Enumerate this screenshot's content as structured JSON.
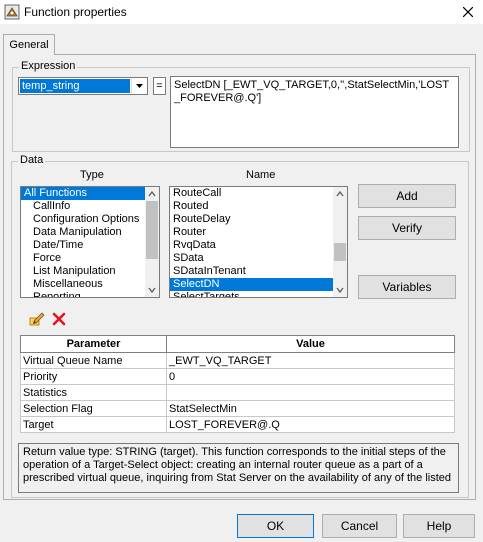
{
  "window": {
    "title": "Function properties"
  },
  "tabs": [
    {
      "label": "General"
    }
  ],
  "expression": {
    "group_label": "Expression",
    "variable_selected": "temp_string",
    "equals_label": "=",
    "text": "SelectDN [_EWT_VQ_TARGET,0,'',StatSelectMin,'LOST_FOREVER@.Q']"
  },
  "data": {
    "group_label": "Data",
    "type_header": "Type",
    "name_header": "Name",
    "types": [
      {
        "label": "All Functions",
        "selected": true
      },
      {
        "label": "CallInfo"
      },
      {
        "label": "Configuration Options"
      },
      {
        "label": "Data Manipulation"
      },
      {
        "label": "Date/Time"
      },
      {
        "label": "Force"
      },
      {
        "label": "List Manipulation"
      },
      {
        "label": "Miscellaneous"
      },
      {
        "label": "Reporting"
      }
    ],
    "names": [
      {
        "label": "RouteCall"
      },
      {
        "label": "Routed"
      },
      {
        "label": "RouteDelay"
      },
      {
        "label": "Router"
      },
      {
        "label": "RvqData"
      },
      {
        "label": "SData"
      },
      {
        "label": "SDataInTenant"
      },
      {
        "label": "SelectDN",
        "selected": true
      },
      {
        "label": "SelectTargets"
      }
    ],
    "buttons": {
      "add": "Add",
      "verify": "Verify",
      "variables": "Variables"
    }
  },
  "params_table": {
    "headers": [
      "Parameter",
      "Value"
    ],
    "rows": [
      [
        "Virtual Queue Name",
        "_EWT_VQ_TARGET"
      ],
      [
        "Priority",
        "0"
      ],
      [
        "Statistics",
        ""
      ],
      [
        "Selection Flag",
        "StatSelectMin"
      ],
      [
        "Target",
        "LOST_FOREVER@.Q"
      ]
    ]
  },
  "description": "Return value type: STRING (target). This function corresponds to the initial steps of the operation of a Target-Select object: creating an internal router queue as a part of a prescribed virtual queue, inquiring from Stat Server on the availability of any of the listed",
  "footer": {
    "ok": "OK",
    "cancel": "Cancel",
    "help": "Help"
  },
  "colors": {
    "selection": "#0078d7",
    "delete_red": "#e81123",
    "window_bg": "#f0f0f0"
  }
}
